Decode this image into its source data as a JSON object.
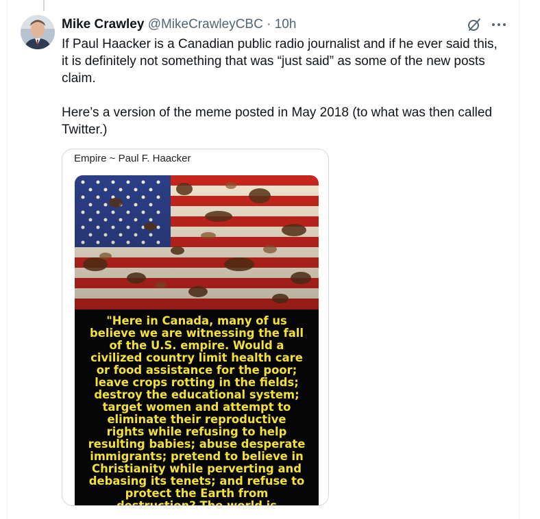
{
  "tweet": {
    "author_name": "Mike Crawley",
    "handle": "@MikeCrawleyCBC",
    "separator": "·",
    "time": "10h",
    "text": "If Paul Haacker is a Canadian public radio journalist and if he ever said this, it is definitely not something that was “just said” as some of the new posts claim.\n\nHere’s a version of the meme posted in May 2018 (to what was then called Twitter.)"
  },
  "actions": {
    "grok_icon": "grok-icon",
    "more_icon": "more-icon",
    "more_glyph": "···"
  },
  "media": {
    "caption": "Empire ~ Paul F. Haacker",
    "quote": "\"Here in Canada, many of us\nbelieve we are witnessing the fall\nof the U.S. empire. Would a\ncivilized country limit health care\nor food assistance for the poor;\nleave crops rotting in the fields;\ndestroy the educational system;\ntarget women and attempt to\neliminate their reproductive\nrights while refusing to help\nresulting babies; abuse desperate\nimmigrants; pretend to believe in\nChristianity while perverting and\ndebasing its tenets; and refuse to\nprotect the Earth from\ndestruction? The world is",
    "quote_color": "#f2e03b"
  },
  "colors": {
    "text": "#0f1419",
    "secondary": "#536471",
    "border": "#cfd9de"
  }
}
